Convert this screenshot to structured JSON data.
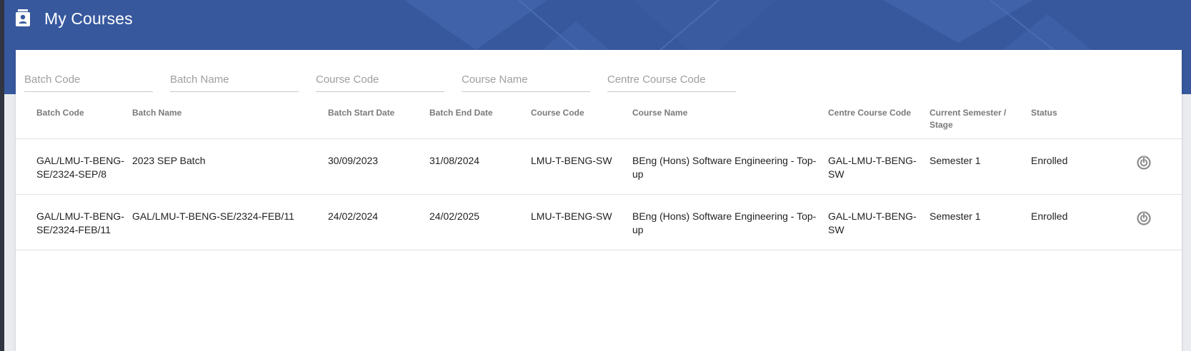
{
  "header": {
    "title": "My Courses",
    "icon": "contact-book-icon"
  },
  "filters": {
    "batch_code_placeholder": "Batch Code",
    "batch_name_placeholder": "Batch Name",
    "course_code_placeholder": "Course Code",
    "course_name_placeholder": "Course Name",
    "centre_course_code_placeholder": "Centre Course Code"
  },
  "table": {
    "columns": [
      "Batch Code",
      "Batch Name",
      "Batch Start Date",
      "Batch End Date",
      "Course Code",
      "Course Name",
      "Centre Course Code",
      "Current Semester / Stage",
      "Status",
      ""
    ],
    "rows": [
      {
        "batch_code": "GAL/LMU-T-BENG-SE/2324-SEP/8",
        "batch_name": "2023 SEP Batch",
        "start_date": "30/09/2023",
        "end_date": "31/08/2024",
        "course_code": "LMU-T-BENG-SW",
        "course_name": "BEng (Hons) Software Engineering - Top-up",
        "centre_course_code": "GAL-LMU-T-BENG-SW",
        "semester": "Semester 1",
        "status": "Enrolled",
        "action_icon": "progress-dial-icon"
      },
      {
        "batch_code": "GAL/LMU-T-BENG-SE/2324-FEB/11",
        "batch_name": "GAL/LMU-T-BENG-SE/2324-FEB/11",
        "start_date": "24/02/2024",
        "end_date": "24/02/2025",
        "course_code": "LMU-T-BENG-SW",
        "course_name": "BEng (Hons) Software Engineering - Top-up",
        "centre_course_code": "GAL-LMU-T-BENG-SW",
        "semester": "Semester 1",
        "status": "Enrolled",
        "action_icon": "progress-dial-icon"
      }
    ]
  },
  "colors": {
    "banner": "#37589d",
    "card": "#ffffff",
    "header_text": "#7a7a7a"
  }
}
